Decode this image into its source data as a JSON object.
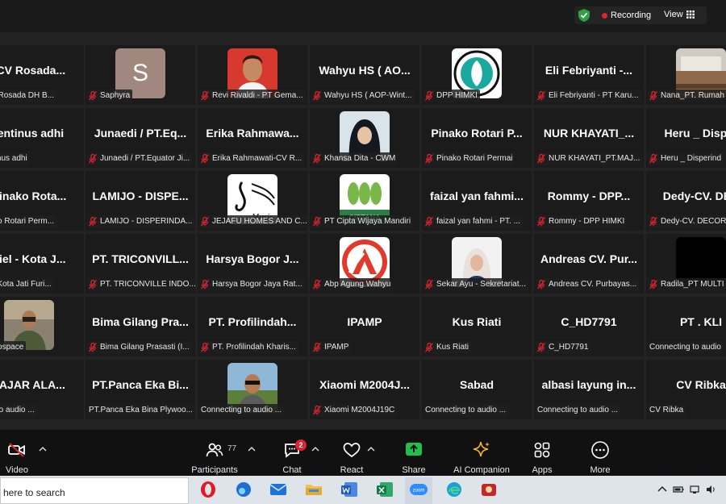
{
  "recording": {
    "label": "Recording",
    "view_label": "View",
    "colors": {
      "dot": "#e0242f",
      "shield": "#2ea043"
    }
  },
  "tiles": [
    {
      "name": "-CV  Rosada...",
      "label": "a-CV Rosada DH B...",
      "muted": false
    },
    {
      "name": "",
      "label": "Saphyra",
      "muted": true,
      "avatar": "S"
    },
    {
      "name": "",
      "label": "Revi Rivaldi - PT Gema...",
      "muted": true,
      "avatar": "photo-man"
    },
    {
      "name": "Wahyu HS ( AO...",
      "label": "Wahyu HS ( AOP-Wint...",
      "muted": true
    },
    {
      "name": "",
      "label": "DPP HIMKI",
      "muted": true,
      "avatar": "logo-himki"
    },
    {
      "name": "Eli Febriyanti  -...",
      "label": "Eli Febriyanti - PT Karu...",
      "muted": true
    },
    {
      "name": "",
      "label": "Nana_PT. Rumah",
      "muted": true,
      "avatar": "photo-room"
    },
    {
      "name": "lentinus adhi",
      "label": "elentinus adhi",
      "muted": false
    },
    {
      "name": "Junaedi / PT.Eq...",
      "label": "Junaedi / PT.Equator Ji...",
      "muted": true
    },
    {
      "name": "Erika  Rahmawa...",
      "label": "Erika Rahmawati-CV R...",
      "muted": true
    },
    {
      "name": "",
      "label": "Khansa Dita - CWM",
      "muted": true,
      "avatar": "photo-hijab"
    },
    {
      "name": "Pinako Rotari P...",
      "label": "Pinako Rotari Permai",
      "muted": true
    },
    {
      "name": "NUR  KHAYATI_...",
      "label": "NUR KHAYATI_PT.MAJ...",
      "muted": true
    },
    {
      "name": "Heru _ Disper",
      "label": "Heru _ Disperind",
      "muted": true
    },
    {
      "name": "Pinako Rota...",
      "label": "Pinako Rotari Perm...",
      "muted": false
    },
    {
      "name": "LAMIJO - DISPE...",
      "label": "LAMIJO - DISPERINDA...",
      "muted": true
    },
    {
      "name": "",
      "label": "JEJAFU HOMES AND C...",
      "muted": true,
      "avatar": "logo-music"
    },
    {
      "name": "",
      "label": "PT Cipta Wijaya Mandiri",
      "muted": true,
      "avatar": "logo-ciptana"
    },
    {
      "name": "faizal yan fahmi...",
      "label": "faizal yan fahmi - PT. ...",
      "muted": true
    },
    {
      "name": "Rommy  -  DPP...",
      "label": "Rommy - DPP HIMKI",
      "muted": true
    },
    {
      "name": "Dedy-CV.  DEC",
      "label": "Dedy-CV. DECOR",
      "muted": true
    },
    {
      "name": "niel - Kota J...",
      "label": "niel - Kota Jati Furi...",
      "muted": false
    },
    {
      "name": "PT.  TRICONVILL...",
      "label": "PT. TRICONVILLE INDO...",
      "muted": true
    },
    {
      "name": "Harsya Bogor J...",
      "label": "Harsya Bogor Jaya Rat...",
      "muted": true
    },
    {
      "name": "",
      "label": "Abp Agung Wahyu",
      "muted": true,
      "avatar": "logo-a"
    },
    {
      "name": "",
      "label": "Sekar Ayu - Sekretariat...",
      "muted": true,
      "avatar": "photo-woman"
    },
    {
      "name": "Andreas  CV.  Pur...",
      "label": "Andreas CV. Purbayas...",
      "muted": true
    },
    {
      "name": "",
      "label": "Radila_PT MULTI",
      "muted": true,
      "avatar": "black"
    },
    {
      "name": "",
      "label": "ry Indospace",
      "muted": false,
      "avatar": "photo-guy"
    },
    {
      "name": "Bima Gilang Pra...",
      "label": "Bima Gilang Prasasti (I...",
      "muted": true
    },
    {
      "name": "PT.  Profilindah...",
      "label": "PT. Profilindah Kharis...",
      "muted": true
    },
    {
      "name": "IPAMP",
      "label": "IPAMP",
      "muted": true
    },
    {
      "name": "Kus Riati",
      "label": "Kus Riati",
      "muted": true
    },
    {
      "name": "C_HD7791",
      "label": "C_HD7791",
      "muted": true
    },
    {
      "name": "PT . KLI",
      "label": "Connecting to audio",
      "muted": false
    },
    {
      "name": "FAJAR  ALA...",
      "label": "cting to audio ...",
      "muted": false
    },
    {
      "name": "PT.Panca  Eka  Bi...",
      "label": "PT.Panca Eka Bina Plywoo...",
      "muted": false
    },
    {
      "name": "",
      "label": "Connecting to audio ...",
      "muted": false,
      "avatar": "photo-outdoor"
    },
    {
      "name": "Xiaomi  M2004J...",
      "label": "Xiaomi M2004J19C",
      "muted": true
    },
    {
      "name": "Sabad",
      "label": "Connecting to audio ...",
      "muted": false
    },
    {
      "name": "albasi  layung  in...",
      "label": "Connecting to audio ...",
      "muted": false
    },
    {
      "name": "CV  Ribka",
      "label": "CV Ribka",
      "muted": false
    }
  ],
  "toolbar": {
    "video": "Video",
    "participants": "Participants",
    "participant_count": "77",
    "chat": "Chat",
    "chat_badge": "2",
    "react": "React",
    "share": "Share",
    "ai": "AI Companion",
    "apps": "Apps",
    "more": "More"
  },
  "taskbar": {
    "search_placeholder": "here to search",
    "zoom_label": "zoom"
  }
}
